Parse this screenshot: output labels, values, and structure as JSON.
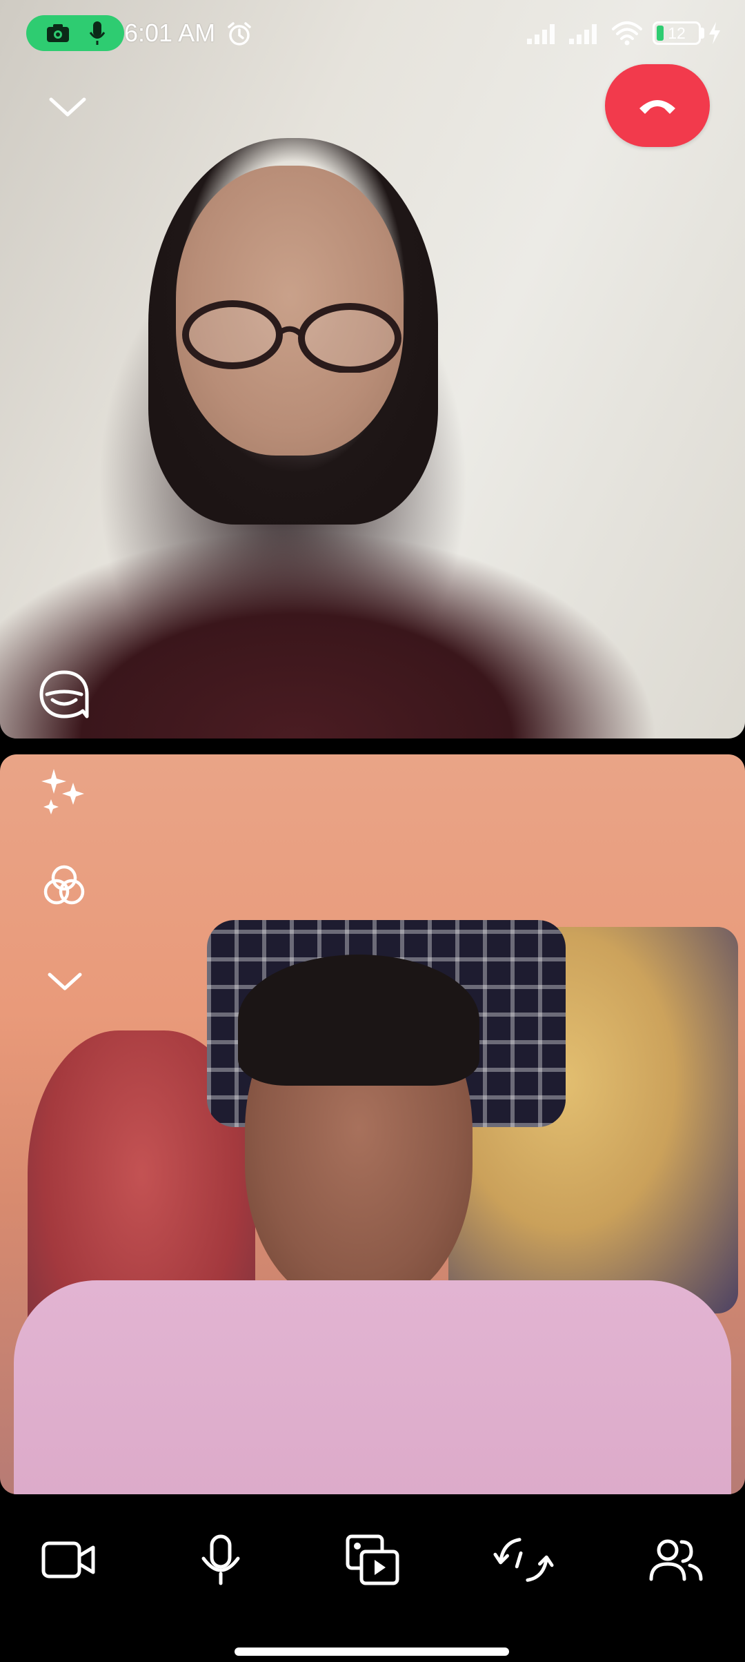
{
  "status_bar": {
    "time": "6:01 AM",
    "battery_level": "12",
    "icons": [
      "camera-icon",
      "microphone-icon",
      "alarm-icon",
      "signal-icon",
      "signal-icon",
      "wifi-icon",
      "battery-icon",
      "charging-icon"
    ]
  },
  "call": {
    "remote_participant_video": "remote-video",
    "local_participant_video": "local-video",
    "top_controls": [
      "chevron-down-icon",
      "end-call-button",
      "lens-icon"
    ],
    "local_controls": [
      "sparkles-icon",
      "filters-icon",
      "chevron-down-icon"
    ]
  },
  "bottom_controls": [
    {
      "icon": "video-camera-icon"
    },
    {
      "icon": "microphone-icon"
    },
    {
      "icon": "share-media-icon"
    },
    {
      "icon": "flip-camera-icon"
    },
    {
      "icon": "participants-icon"
    }
  ],
  "colors": {
    "end_call": "#f23a4c",
    "privacy_indicator": "#2ecc71",
    "background": "#000000",
    "icons": "#ffffff"
  }
}
